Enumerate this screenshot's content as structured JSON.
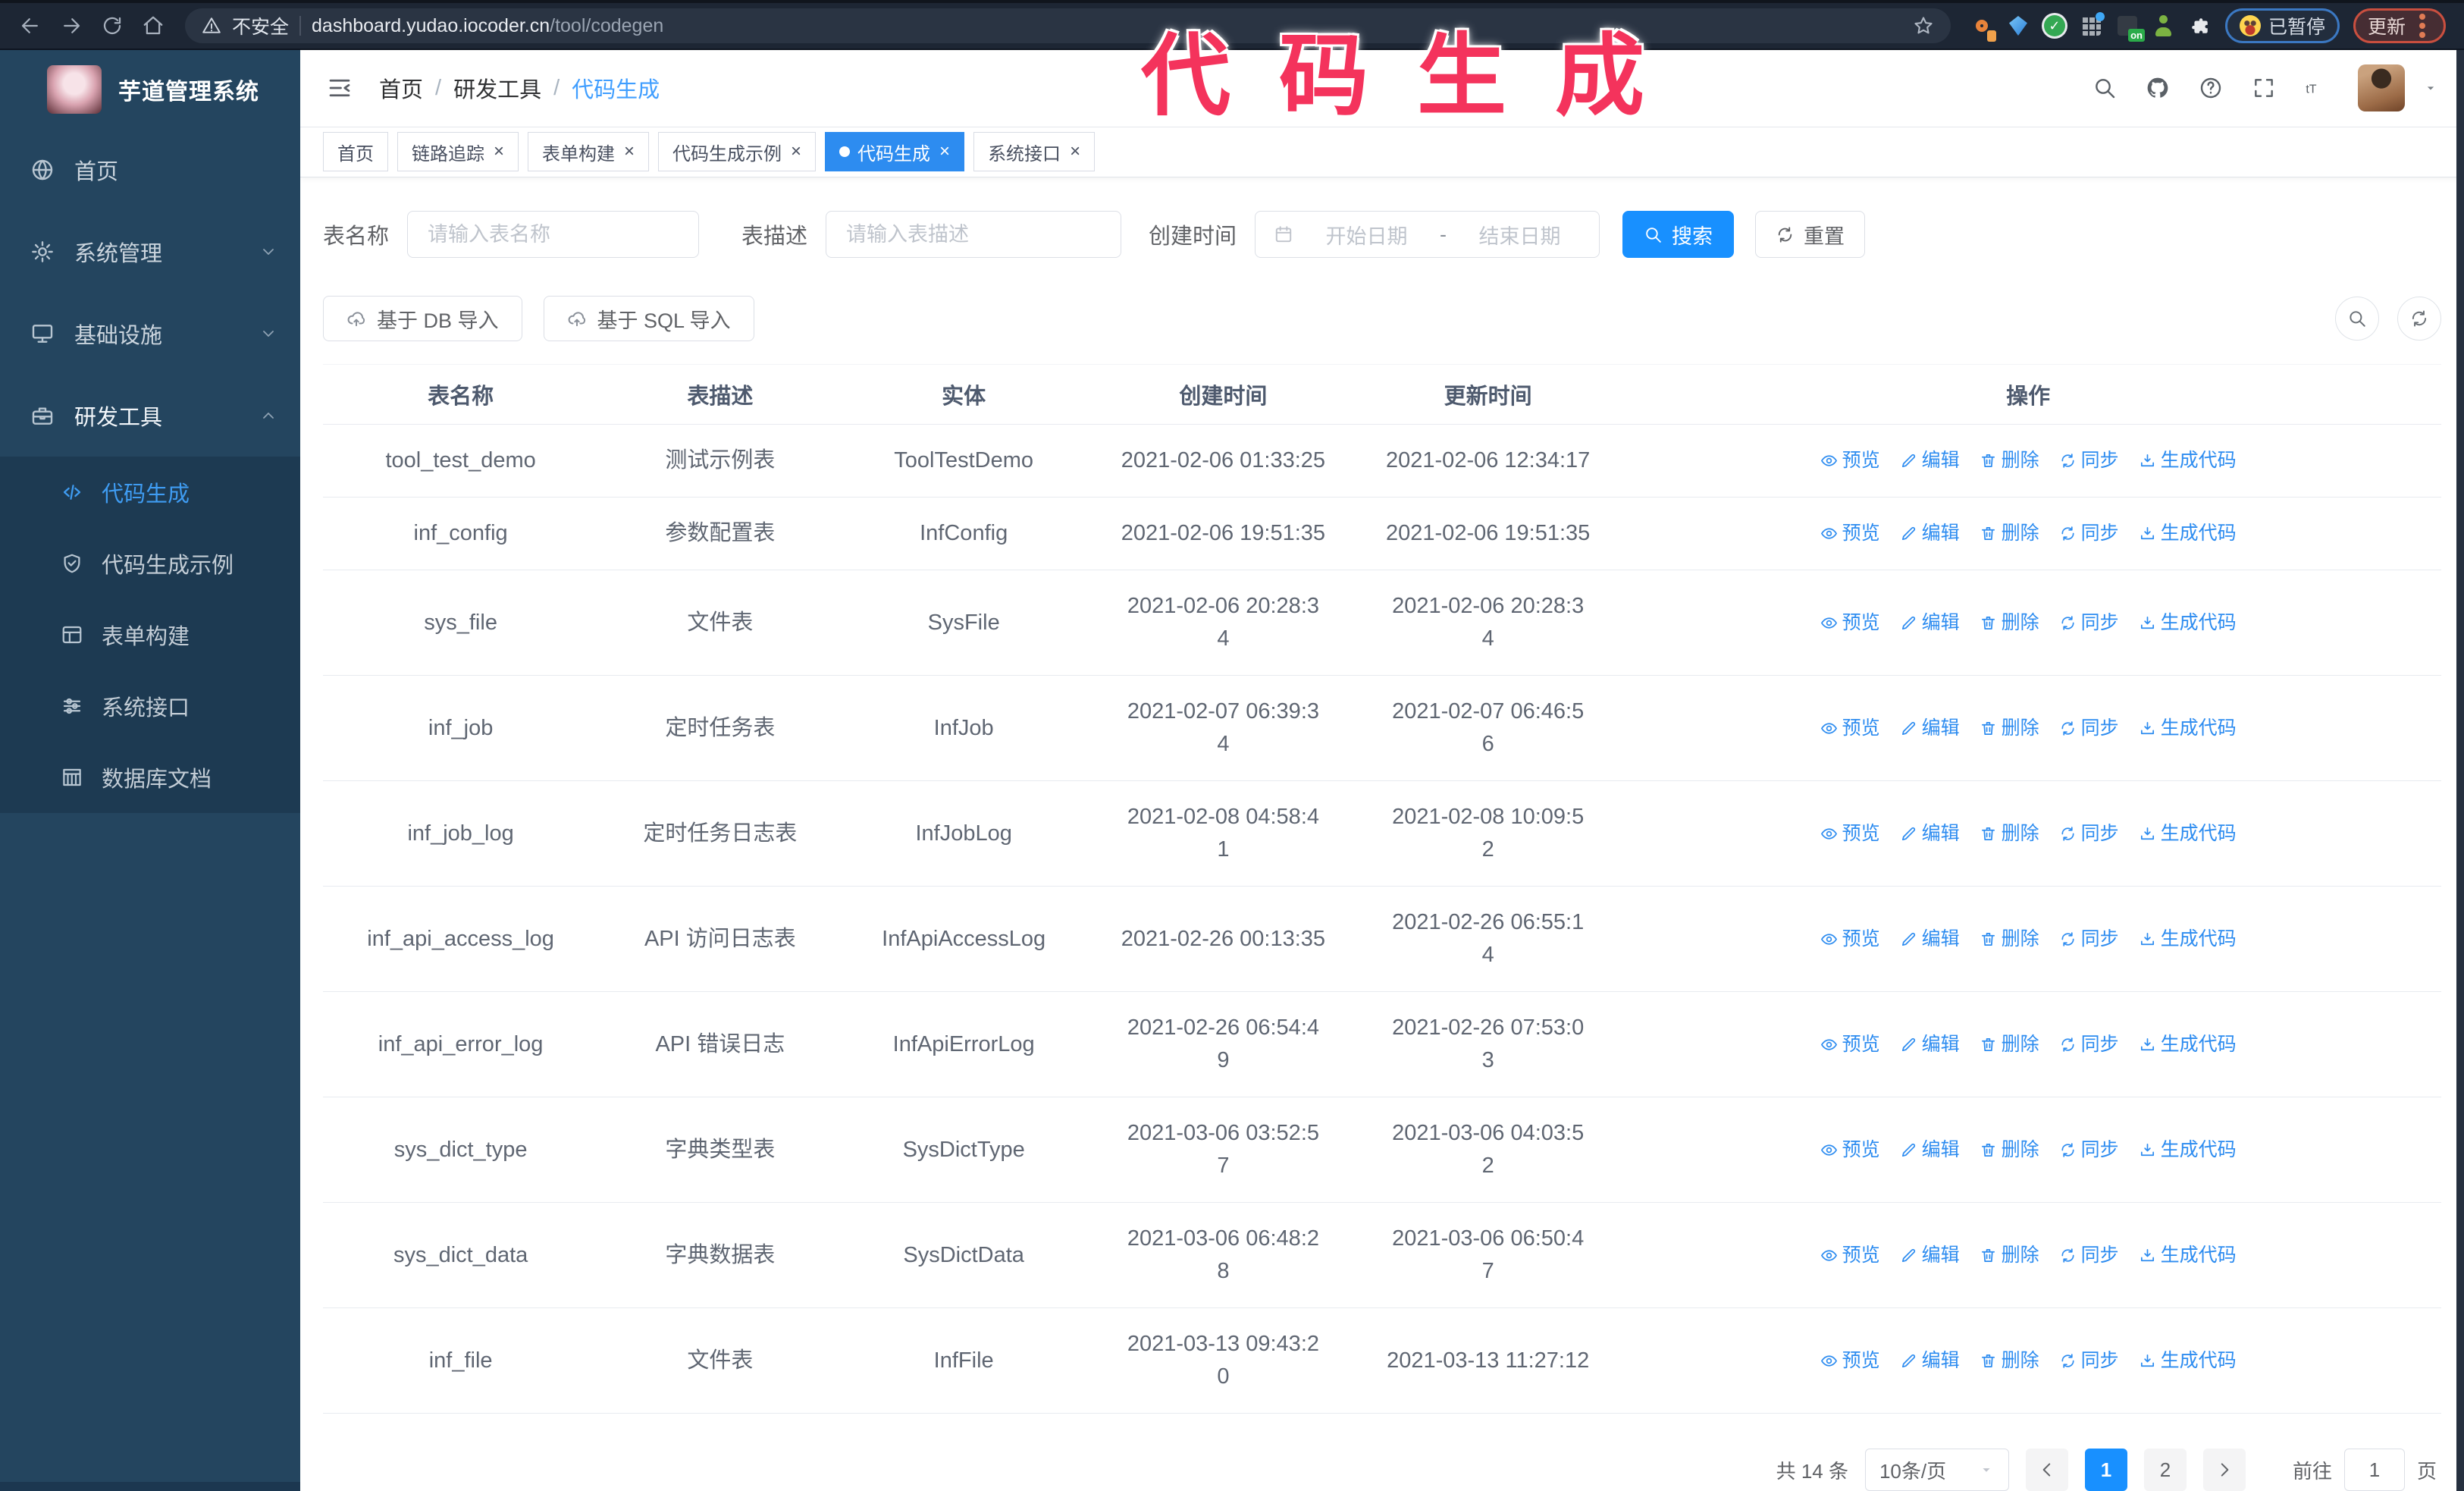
{
  "browser": {
    "security_label": "不安全",
    "url_domain": "dashboard.yudao.iocoder.cn",
    "url_path": "/tool/codegen",
    "ext_on_badge": "on",
    "paused_badge_label": "已暂停",
    "update_badge_label": "更新"
  },
  "annotation": {
    "text": "代码生成"
  },
  "colors": {
    "accent": "#1890ff",
    "annotation": "#f4335c",
    "sidebar_bg": "#24455f",
    "submenu_bg": "#1d3a52",
    "active_tab": "#2d8cf0"
  },
  "sidebar": {
    "title": "芋道管理系统",
    "menu": [
      {
        "label": "首页",
        "icon": "dashboard-icon"
      },
      {
        "label": "系统管理",
        "icon": "gear-icon",
        "chevron": "down"
      },
      {
        "label": "基础设施",
        "icon": "monitor-icon",
        "chevron": "down"
      },
      {
        "label": "研发工具",
        "icon": "toolbox-icon",
        "chevron": "up",
        "active": true
      }
    ],
    "submenu": [
      {
        "label": "代码生成",
        "icon": "code-icon",
        "active": true
      },
      {
        "label": "代码生成示例",
        "icon": "shield-icon"
      },
      {
        "label": "表单构建",
        "icon": "form-icon"
      },
      {
        "label": "系统接口",
        "icon": "sliders-icon"
      },
      {
        "label": "数据库文档",
        "icon": "database-icon"
      }
    ]
  },
  "topbar": {
    "breadcrumb": [
      {
        "label": "首页"
      },
      {
        "label": "研发工具"
      },
      {
        "label": "代码生成",
        "current": true
      }
    ],
    "icons": [
      "search-icon",
      "github-icon",
      "question-icon",
      "fullscreen-icon",
      "font-size-icon"
    ]
  },
  "tabs": [
    {
      "label": "首页"
    },
    {
      "label": "链路追踪",
      "closable": true
    },
    {
      "label": "表单构建",
      "closable": true
    },
    {
      "label": "代码生成示例",
      "closable": true
    },
    {
      "label": "代码生成",
      "closable": true,
      "active": true
    },
    {
      "label": "系统接口",
      "closable": true
    }
  ],
  "filters": {
    "table_name_label": "表名称",
    "table_name_placeholder": "请输入表名称",
    "table_desc_label": "表描述",
    "table_desc_placeholder": "请输入表描述",
    "create_time_label": "创建时间",
    "date_start_placeholder": "开始日期",
    "date_separator": "-",
    "date_end_placeholder": "结束日期",
    "search_label": "搜索",
    "reset_label": "重置"
  },
  "toolbar": {
    "import_db_label": "基于 DB 导入",
    "import_sql_label": "基于 SQL 导入"
  },
  "table": {
    "columns": [
      "表名称",
      "表描述",
      "实体",
      "创建时间",
      "更新时间",
      "操作"
    ],
    "actions": [
      {
        "label": "预览",
        "icon": "eye-icon"
      },
      {
        "label": "编辑",
        "icon": "edit-icon"
      },
      {
        "label": "删除",
        "icon": "delete-icon"
      },
      {
        "label": "同步",
        "icon": "sync-icon"
      },
      {
        "label": "生成代码",
        "icon": "download-icon"
      }
    ],
    "rows": [
      {
        "name": "tool_test_demo",
        "desc": "测试示例表",
        "entity": "ToolTestDemo",
        "created": "2021-02-06 01:33:25",
        "updated": "2021-02-06 12:34:17"
      },
      {
        "name": "inf_config",
        "desc": "参数配置表",
        "entity": "InfConfig",
        "created": "2021-02-06 19:51:35",
        "updated": "2021-02-06 19:51:35"
      },
      {
        "name": "sys_file",
        "desc": "文件表",
        "entity": "SysFile",
        "created": "2021-02-06 20:28:3\n4",
        "updated": "2021-02-06 20:28:3\n4"
      },
      {
        "name": "inf_job",
        "desc": "定时任务表",
        "entity": "InfJob",
        "created": "2021-02-07 06:39:3\n4",
        "updated": "2021-02-07 06:46:5\n6"
      },
      {
        "name": "inf_job_log",
        "desc": "定时任务日志表",
        "entity": "InfJobLog",
        "created": "2021-02-08 04:58:4\n1",
        "updated": "2021-02-08 10:09:5\n2"
      },
      {
        "name": "inf_api_access_log",
        "desc": "API 访问日志表",
        "entity": "InfApiAccessLog",
        "created": "2021-02-26 00:13:35",
        "updated": "2021-02-26 06:55:1\n4"
      },
      {
        "name": "inf_api_error_log",
        "desc": "API 错误日志",
        "entity": "InfApiErrorLog",
        "created": "2021-02-26 06:54:4\n9",
        "updated": "2021-02-26 07:53:0\n3"
      },
      {
        "name": "sys_dict_type",
        "desc": "字典类型表",
        "entity": "SysDictType",
        "created": "2021-03-06 03:52:5\n7",
        "updated": "2021-03-06 04:03:5\n2"
      },
      {
        "name": "sys_dict_data",
        "desc": "字典数据表",
        "entity": "SysDictData",
        "created": "2021-03-06 06:48:2\n8",
        "updated": "2021-03-06 06:50:4\n7"
      },
      {
        "name": "inf_file",
        "desc": "文件表",
        "entity": "InfFile",
        "created": "2021-03-13 09:43:2\n0",
        "updated": "2021-03-13 11:27:12"
      }
    ]
  },
  "pagination": {
    "total_label": "共 14 条",
    "page_size_label": "10条/页",
    "pages": [
      "1",
      "2"
    ],
    "active_page": "1",
    "goto_label": "前往",
    "goto_value": "1",
    "goto_unit": "页"
  }
}
